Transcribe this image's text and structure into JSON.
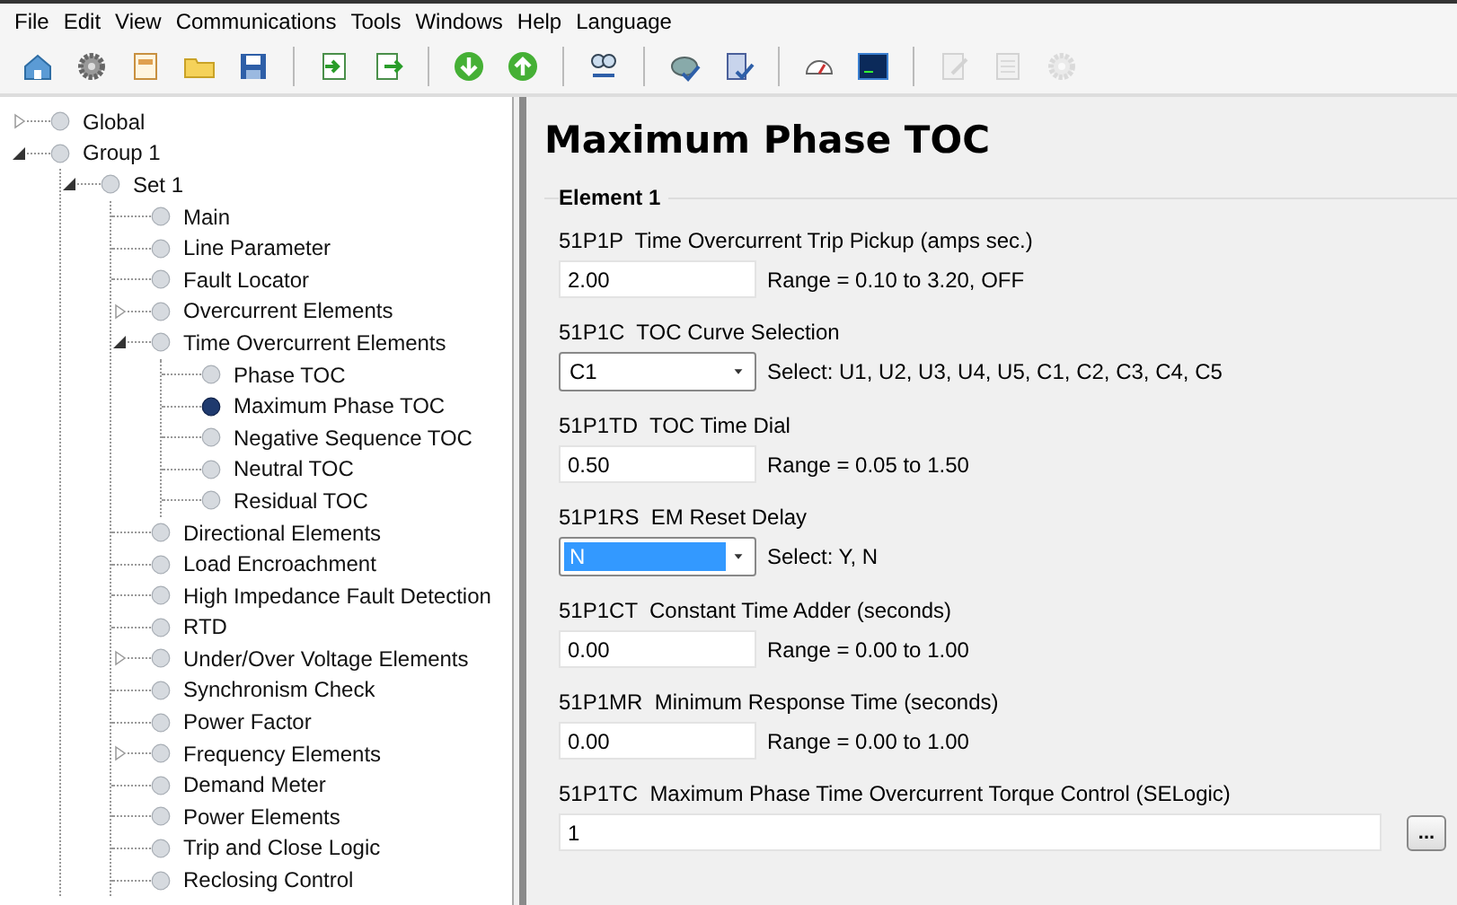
{
  "menu": [
    "File",
    "Edit",
    "View",
    "Communications",
    "Tools",
    "Windows",
    "Help",
    "Language"
  ],
  "toolbar": [
    [
      {
        "disabled": false
      },
      {
        "disabled": false
      },
      {
        "disabled": false
      },
      {
        "disabled": false
      },
      {
        "disabled": false
      }
    ],
    [
      {
        "disabled": false
      },
      {
        "disabled": false
      }
    ],
    [
      {
        "disabled": false
      },
      {
        "disabled": false
      }
    ],
    [
      {
        "disabled": false
      }
    ],
    [
      {
        "disabled": false
      },
      {
        "disabled": false
      }
    ],
    [
      {
        "disabled": false
      },
      {
        "disabled": false
      }
    ],
    [
      {
        "disabled": true
      },
      {
        "disabled": true
      },
      {
        "disabled": true
      }
    ]
  ],
  "tree": [
    {
      "label": "Global",
      "expanded": false,
      "selected": false
    },
    {
      "label": "Group 1",
      "expanded": true,
      "selected": false,
      "children": [
        {
          "label": "Set 1",
          "expanded": true,
          "selected": false,
          "children": [
            {
              "label": "Main",
              "selected": false
            },
            {
              "label": "Line Parameter",
              "selected": false
            },
            {
              "label": "Fault Locator",
              "selected": false
            },
            {
              "label": "Overcurrent Elements",
              "expanded": false,
              "selected": false
            },
            {
              "label": "Time Overcurrent Elements",
              "expanded": true,
              "selected": false,
              "children": [
                {
                  "label": "Phase TOC",
                  "selected": false
                },
                {
                  "label": "Maximum Phase TOC",
                  "selected": true
                },
                {
                  "label": "Negative Sequence TOC",
                  "selected": false
                },
                {
                  "label": "Neutral TOC",
                  "selected": false
                },
                {
                  "label": "Residual TOC",
                  "selected": false
                }
              ]
            },
            {
              "label": "Directional Elements",
              "selected": false
            },
            {
              "label": "Load Encroachment",
              "selected": false
            },
            {
              "label": "High Impedance Fault Detection",
              "selected": false
            },
            {
              "label": "RTD",
              "selected": false
            },
            {
              "label": "Under/Over Voltage Elements",
              "expanded": false,
              "selected": false
            },
            {
              "label": "Synchronism Check",
              "selected": false
            },
            {
              "label": "Power Factor",
              "selected": false
            },
            {
              "label": "Frequency Elements",
              "expanded": false,
              "selected": false
            },
            {
              "label": "Demand Meter",
              "selected": false
            },
            {
              "label": "Power Elements",
              "selected": false
            },
            {
              "label": "Trip and Close Logic",
              "selected": false
            },
            {
              "label": "Reclosing Control",
              "selected": false
            }
          ]
        }
      ]
    }
  ],
  "form": {
    "title": "Maximum Phase TOC",
    "section": "Element 1",
    "settings": [
      {
        "kind": "text",
        "code": "51P1P",
        "label": "Time Overcurrent Trip Pickup (amps sec.)",
        "value": "2.00",
        "hint": "Range = 0.10 to 3.20, OFF"
      },
      {
        "kind": "select",
        "code": "51P1C",
        "label": "TOC Curve Selection",
        "value": "C1",
        "focused": false,
        "hint": "Select: U1, U2, U3, U4, U5, C1, C2, C3, C4, C5"
      },
      {
        "kind": "text",
        "code": "51P1TD",
        "label": "TOC Time Dial",
        "value": "0.50",
        "hint": "Range = 0.05 to 1.50"
      },
      {
        "kind": "select",
        "code": "51P1RS",
        "label": "EM Reset Delay",
        "value": "N",
        "focused": true,
        "hint": "Select: Y, N"
      },
      {
        "kind": "text",
        "code": "51P1CT",
        "label": "Constant Time Adder (seconds)",
        "value": "0.00",
        "hint": "Range = 0.00 to 1.00"
      },
      {
        "kind": "text",
        "code": "51P1MR",
        "label": "Minimum Response Time (seconds)",
        "value": "0.00",
        "hint": "Range = 0.00 to 1.00"
      },
      {
        "kind": "logic",
        "code": "51P1TC",
        "label": "Maximum Phase Time Overcurrent Torque Control (SELogic)",
        "value": "1",
        "button": "..."
      }
    ]
  }
}
